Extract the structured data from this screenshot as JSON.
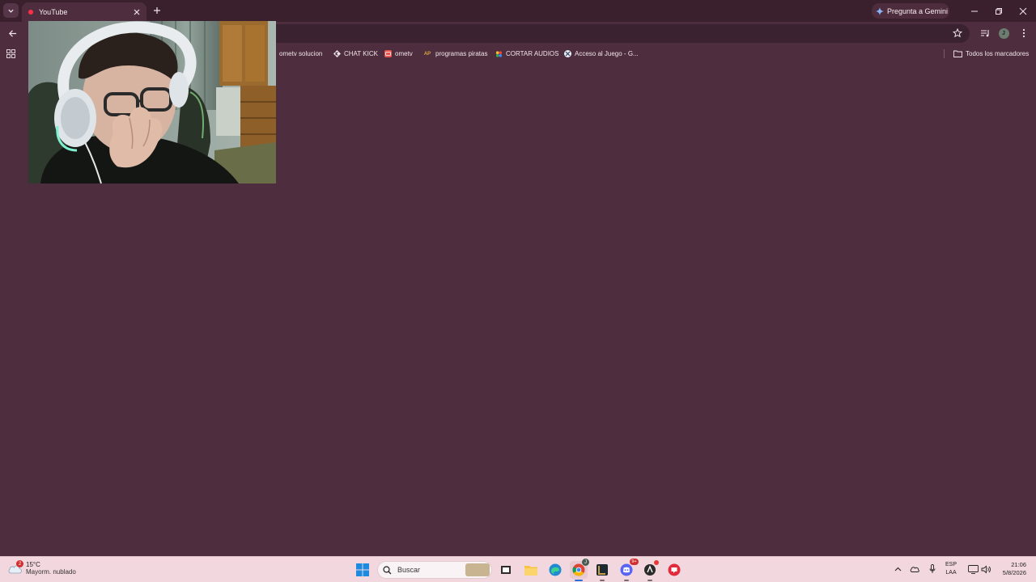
{
  "browser": {
    "tab": {
      "title": "YouTube"
    },
    "gemini_button": {
      "label": "Pregunta a Gemini"
    },
    "profile_initial": "J"
  },
  "bookmarks": {
    "items": [
      {
        "label": "ometv solucion",
        "icon": "bookmark-favicon-icon"
      },
      {
        "label": "CHAT KICK",
        "icon": "kick-icon"
      },
      {
        "label": "ometv",
        "icon": "ometv-icon"
      },
      {
        "label": "programas piratas",
        "icon": "ap-icon",
        "icon_text": "AP"
      },
      {
        "label": "CORTAR AUDIOS",
        "icon": "audio-cut-icon"
      },
      {
        "label": "Acceso al Juego - G...",
        "icon": "x-icon"
      }
    ],
    "all_bookmarks": "Todos los marcadores"
  },
  "taskbar": {
    "weather": {
      "badge": "2",
      "temp": "15°C",
      "desc": "Mayorm. nublado"
    },
    "search": {
      "placeholder": "Buscar"
    },
    "tray": {
      "lang_top": "ESP",
      "lang_bottom": "LAA",
      "time": "21:06",
      "date": "5/8/2026"
    },
    "badges": {
      "chrome": "J",
      "discord": "9+"
    }
  },
  "colors": {
    "page_bg": "#4e2e3e",
    "titlebar_bg": "#3a1f2d",
    "taskbar_bg": "#f2d7de",
    "youtube_red": "#ff2f4a"
  }
}
